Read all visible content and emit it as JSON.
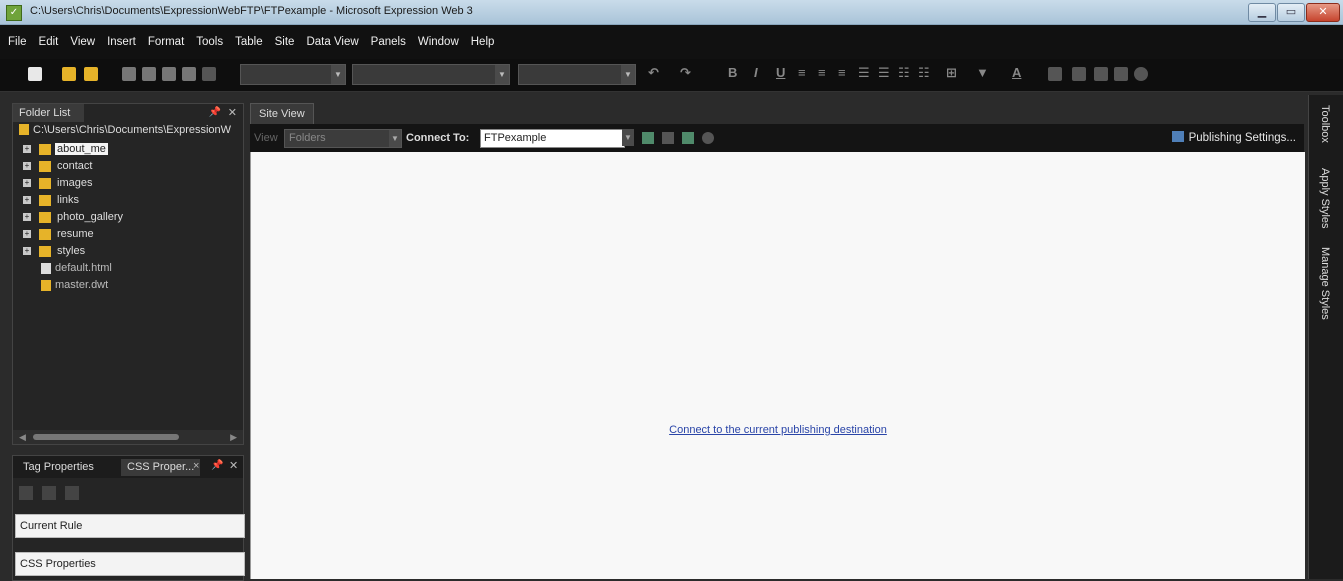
{
  "window": {
    "title": "C:\\Users\\Chris\\Documents\\ExpressionWebFTP\\FTPexample - Microsoft Expression Web 3"
  },
  "menu": [
    "File",
    "Edit",
    "View",
    "Insert",
    "Format",
    "Tools",
    "Table",
    "Site",
    "Data View",
    "Panels",
    "Window",
    "Help"
  ],
  "folder_list": {
    "tab_label": "Folder List",
    "path": "C:\\Users\\Chris\\Documents\\ExpressionW",
    "folders": [
      {
        "label": "about_me",
        "selected": true
      },
      {
        "label": "contact"
      },
      {
        "label": "images"
      },
      {
        "label": "links"
      },
      {
        "label": "photo_gallery"
      },
      {
        "label": "resume"
      },
      {
        "label": "styles"
      }
    ],
    "files": [
      {
        "label": "default.html",
        "icon": "home-page-icon"
      },
      {
        "label": "master.dwt",
        "icon": "template-icon"
      }
    ]
  },
  "tag_panel": {
    "tabs": [
      "Tag Properties",
      "CSS Proper..."
    ],
    "current_rule": "Current Rule",
    "css_properties": "CSS Properties"
  },
  "site_view": {
    "tab_label": "Site View",
    "view_label": "View",
    "view_value": "Folders",
    "connect_label": "Connect To:",
    "connect_value": "FTPexample",
    "publishing_settings": "Publishing Settings...",
    "connect_link": "Connect to the current publishing destination"
  },
  "right_panels": [
    "Toolbox",
    "Apply Styles",
    "Manage Styles"
  ],
  "colors": {
    "chrome_dark": "#111111",
    "titlebar": "#c9dcea",
    "link": "#2a45a8",
    "folder": "#e6b329"
  }
}
